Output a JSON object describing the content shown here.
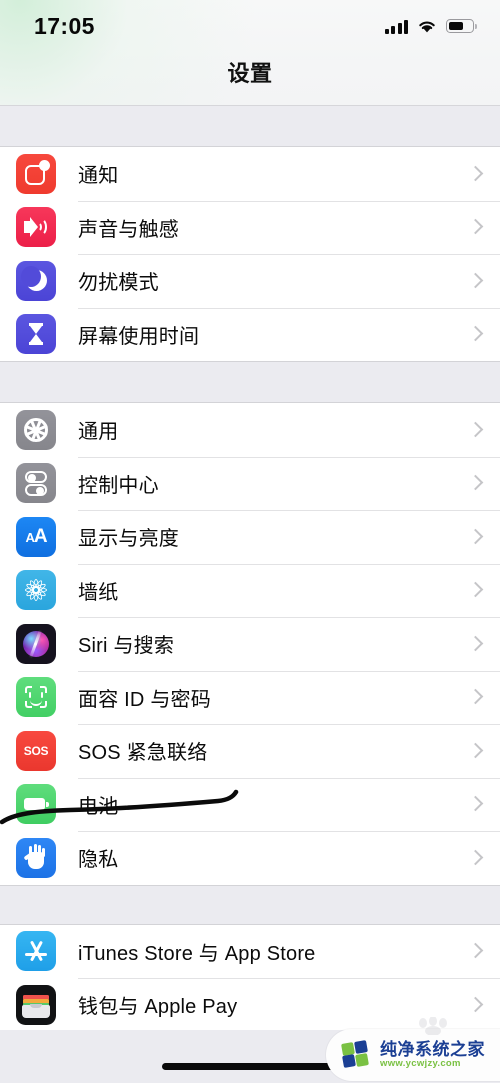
{
  "status_bar": {
    "time": "17:05",
    "signal_icon": "cellular-signal-icon",
    "wifi_icon": "wifi-icon",
    "battery_icon": "battery-icon",
    "battery_level_percent": 62
  },
  "nav": {
    "title": "设置"
  },
  "groups": [
    {
      "id": "group-1",
      "rows": [
        {
          "label": "通知",
          "icon": "notifications-icon",
          "icon_color": "#f7483d"
        },
        {
          "label": "声音与触感",
          "icon": "sounds-haptics-icon",
          "icon_color": "#f7375a"
        },
        {
          "label": "勿扰模式",
          "icon": "do-not-disturb-icon",
          "icon_color": "#5b56e0"
        },
        {
          "label": "屏幕使用时间",
          "icon": "screen-time-icon",
          "icon_color": "#5b56e0"
        }
      ]
    },
    {
      "id": "group-2",
      "rows": [
        {
          "label": "通用",
          "icon": "general-gear-icon",
          "icon_color": "#93939a"
        },
        {
          "label": "控制中心",
          "icon": "control-center-icon",
          "icon_color": "#93939a"
        },
        {
          "label": "显示与亮度",
          "icon": "display-brightness-icon",
          "icon_color": "#1d87f4"
        },
        {
          "label": "墙纸",
          "icon": "wallpaper-icon",
          "icon_color": "#41b6e8"
        },
        {
          "label": "Siri 与搜索",
          "icon": "siri-search-icon",
          "icon_color": "#15121e"
        },
        {
          "label": "面容 ID 与密码",
          "icon": "face-id-icon",
          "icon_color": "#5fdd7d"
        },
        {
          "label": "SOS 紧急联络",
          "icon": "emergency-sos-icon",
          "icon_color": "#f8493f",
          "icon_text": "SOS"
        },
        {
          "label": "电池",
          "icon": "battery-settings-icon",
          "icon_color": "#5fdd7d",
          "annotated": true
        },
        {
          "label": "隐私",
          "icon": "privacy-hand-icon",
          "icon_color": "#2f87f5"
        }
      ]
    },
    {
      "id": "group-3",
      "rows": [
        {
          "label": "iTunes Store 与 App Store",
          "icon": "app-store-icon",
          "icon_color": "#36b6f2"
        },
        {
          "label": "钱包与 Apple Pay",
          "icon": "wallet-apple-pay-icon",
          "icon_color": "#111214"
        }
      ]
    }
  ],
  "display_icon_text": {
    "small_a": "A",
    "large_a": "A"
  },
  "annotation": {
    "type": "hand-drawn-underline",
    "color": "#0b0b0b",
    "target_row": "电池"
  },
  "footer": {
    "home_indicator": "home-indicator"
  },
  "watermark": {
    "title": "纯净系统之家",
    "url": "www.ycwjzy.com",
    "logo_colors": [
      "#7ac143",
      "#1b3f94"
    ]
  }
}
